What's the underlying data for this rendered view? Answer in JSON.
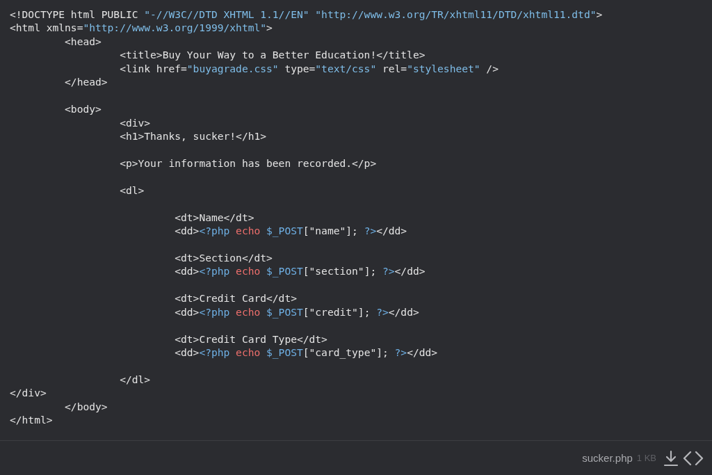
{
  "code_lines": [
    {
      "kind": "code",
      "tokens": [
        {
          "kind": "plain",
          "text": "<!DOCTYPE html PUBLIC "
        },
        {
          "kind": "string",
          "text": "\"-//W3C//DTD XHTML 1.1//EN\" "
        },
        {
          "kind": "string",
          "text": "\"http://www.w3.org/TR/xhtml11/DTD/xhtml11.dtd\""
        },
        {
          "kind": "plain",
          "text": ">"
        }
      ]
    },
    {
      "kind": "code",
      "tokens": [
        {
          "kind": "plain",
          "text": "<html xmlns="
        },
        {
          "kind": "string",
          "text": "\"http://www.w3.org/1999/xhtml\""
        },
        {
          "kind": "plain",
          "text": ">"
        }
      ]
    },
    {
      "kind": "code",
      "tokens": [
        {
          "kind": "plain",
          "text": "\t<head>"
        }
      ]
    },
    {
      "kind": "code",
      "tokens": [
        {
          "kind": "plain",
          "text": "\t\t<title>Buy Your Way to a Better Education!</title>"
        }
      ]
    },
    {
      "kind": "code",
      "tokens": [
        {
          "kind": "plain",
          "text": "\t\t<link href="
        },
        {
          "kind": "string",
          "text": "\"buyagrade.css\""
        },
        {
          "kind": "plain",
          "text": " type="
        },
        {
          "kind": "string",
          "text": "\"text/css\""
        },
        {
          "kind": "plain",
          "text": " rel="
        },
        {
          "kind": "string",
          "text": "\"stylesheet\""
        },
        {
          "kind": "plain",
          "text": " />"
        }
      ]
    },
    {
      "kind": "code",
      "tokens": [
        {
          "kind": "plain",
          "text": "\t</head>"
        }
      ]
    },
    {
      "kind": "blank"
    },
    {
      "kind": "code",
      "tokens": [
        {
          "kind": "plain",
          "text": "\t<body>"
        }
      ]
    },
    {
      "kind": "code",
      "tokens": [
        {
          "kind": "plain",
          "text": "\t\t<div>"
        }
      ]
    },
    {
      "kind": "code",
      "tokens": [
        {
          "kind": "plain",
          "text": "\t\t<h1>Thanks, sucker!</h1>"
        }
      ]
    },
    {
      "kind": "blank"
    },
    {
      "kind": "code",
      "tokens": [
        {
          "kind": "plain",
          "text": "\t\t<p>Your information has been recorded.</p>"
        }
      ]
    },
    {
      "kind": "blank"
    },
    {
      "kind": "code",
      "tokens": [
        {
          "kind": "plain",
          "text": "\t\t<dl>"
        }
      ]
    },
    {
      "kind": "blank"
    },
    {
      "kind": "code",
      "tokens": [
        {
          "kind": "plain",
          "text": "\t\t\t<dt>Name</dt>"
        }
      ]
    },
    {
      "kind": "code",
      "tokens": [
        {
          "kind": "plain",
          "text": "\t\t\t<dd>"
        },
        {
          "kind": "php",
          "text": "<?php "
        },
        {
          "kind": "keyword",
          "text": "echo "
        },
        {
          "kind": "php",
          "text": "$_POST"
        },
        {
          "kind": "plain",
          "text": "[\"name\"]; "
        },
        {
          "kind": "php",
          "text": "?>"
        },
        {
          "kind": "plain",
          "text": "</dd>"
        }
      ]
    },
    {
      "kind": "blank"
    },
    {
      "kind": "code",
      "tokens": [
        {
          "kind": "plain",
          "text": "\t\t\t<dt>Section</dt>"
        }
      ]
    },
    {
      "kind": "code",
      "tokens": [
        {
          "kind": "plain",
          "text": "\t\t\t<dd>"
        },
        {
          "kind": "php",
          "text": "<?php "
        },
        {
          "kind": "keyword",
          "text": "echo "
        },
        {
          "kind": "php",
          "text": "$_POST"
        },
        {
          "kind": "plain",
          "text": "[\"section\"]; "
        },
        {
          "kind": "php",
          "text": "?>"
        },
        {
          "kind": "plain",
          "text": "</dd>"
        }
      ]
    },
    {
      "kind": "blank"
    },
    {
      "kind": "code",
      "tokens": [
        {
          "kind": "plain",
          "text": "\t\t\t<dt>Credit Card</dt>"
        }
      ]
    },
    {
      "kind": "code",
      "tokens": [
        {
          "kind": "plain",
          "text": "\t\t\t<dd>"
        },
        {
          "kind": "php",
          "text": "<?php "
        },
        {
          "kind": "keyword",
          "text": "echo "
        },
        {
          "kind": "php",
          "text": "$_POST"
        },
        {
          "kind": "plain",
          "text": "[\"credit\"]; "
        },
        {
          "kind": "php",
          "text": "?>"
        },
        {
          "kind": "plain",
          "text": "</dd>"
        }
      ]
    },
    {
      "kind": "blank"
    },
    {
      "kind": "code",
      "tokens": [
        {
          "kind": "plain",
          "text": "\t\t\t<dt>Credit Card Type</dt>"
        }
      ]
    },
    {
      "kind": "code",
      "tokens": [
        {
          "kind": "plain",
          "text": "\t\t\t<dd>"
        },
        {
          "kind": "php",
          "text": "<?php "
        },
        {
          "kind": "keyword",
          "text": "echo "
        },
        {
          "kind": "php",
          "text": "$_POST"
        },
        {
          "kind": "plain",
          "text": "[\"card_type\"]; "
        },
        {
          "kind": "php",
          "text": "?>"
        },
        {
          "kind": "plain",
          "text": "</dd>"
        }
      ]
    },
    {
      "kind": "blank"
    },
    {
      "kind": "code",
      "tokens": [
        {
          "kind": "plain",
          "text": "\t\t</dl>"
        }
      ]
    },
    {
      "kind": "code",
      "tokens": [
        {
          "kind": "plain",
          "text": "</div>"
        }
      ]
    },
    {
      "kind": "code",
      "tokens": [
        {
          "kind": "plain",
          "text": "\t</body>"
        }
      ]
    },
    {
      "kind": "code",
      "tokens": [
        {
          "kind": "plain",
          "text": "</html>"
        }
      ]
    }
  ],
  "footer": {
    "filename": "sucker.php",
    "size": "1 KB"
  }
}
